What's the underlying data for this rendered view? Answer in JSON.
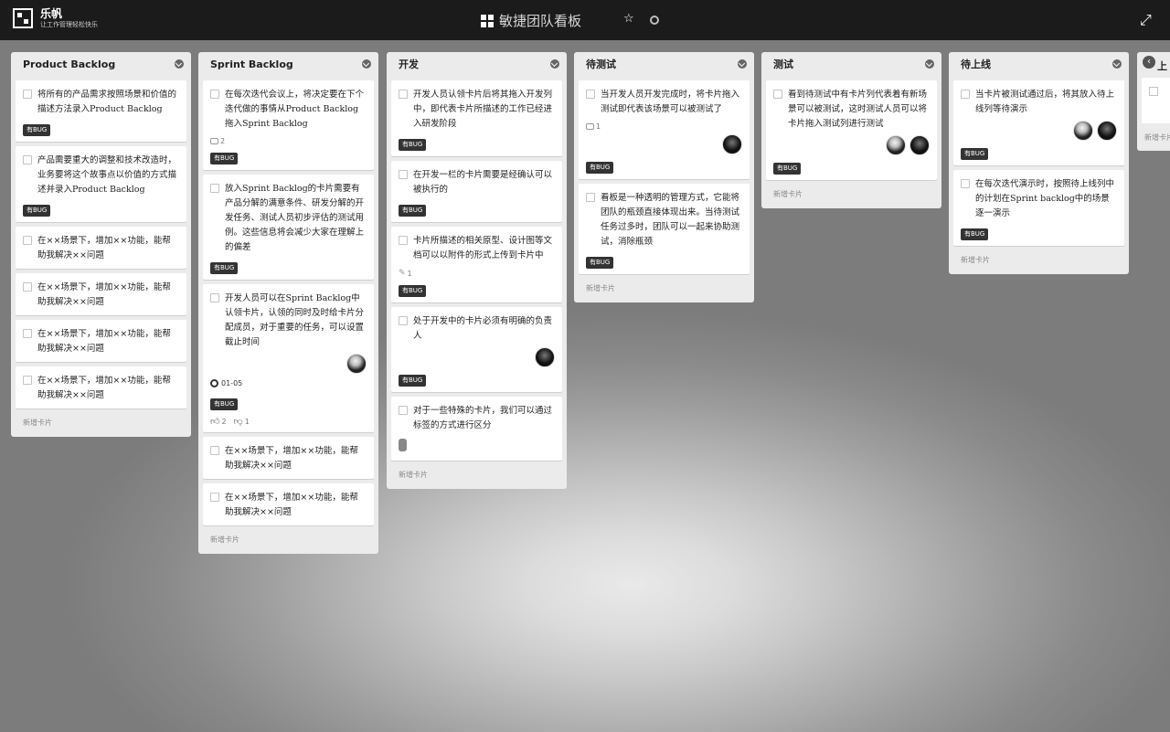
{
  "app": {
    "name": "乐帆",
    "tagline": "让工作管理轻松快乐"
  },
  "board": {
    "title": "敏捷团队看板"
  },
  "add_card_label": "新增卡片",
  "partial_list": {
    "title": "上"
  },
  "lists": [
    {
      "title": "Product Backlog",
      "cards": [
        {
          "text": "将所有的产品需求按照场景和价值的描述方法录入Product Backlog",
          "label": "有BUG"
        },
        {
          "text": "产品需要重大的调整和技术改造时，业务要将这个故事点以价值的方式描述并录入Product Backlog",
          "label": "有BUG"
        },
        {
          "text": "在××场景下，增加××功能，能帮助我解决××问题"
        },
        {
          "text": "在××场景下，增加××功能，能帮助我解决××问题"
        },
        {
          "text": "在××场景下，增加××功能，能帮助我解决××问题"
        },
        {
          "text": "在××场景下，增加××功能，能帮助我解决××问题"
        }
      ]
    },
    {
      "title": "Sprint Backlog",
      "cards": [
        {
          "text": "在每次迭代会议上，将决定要在下个迭代做的事情从Product Backlog拖入Sprint Backlog",
          "comments": "2",
          "label": "有BUG"
        },
        {
          "text": "放入Sprint Backlog的卡片需要有产品分解的满意条件、研发分解的开发任务、测试人员初步评估的测试用例。这些信息将会减少大家在理解上的偏差",
          "label": "有BUG"
        },
        {
          "text": "开发人员可以在Sprint Backlog中认领卡片，认领的同时及时给卡片分配成员，对于重要的任务，可以设置截止时间",
          "avatars": [
            "light"
          ],
          "due": "01-05",
          "label": "有BUG",
          "likes": "2",
          "dislikes": "1"
        },
        {
          "text": "在××场景下，增加××功能，能帮助我解决××问题"
        },
        {
          "text": "在××场景下，增加××功能，能帮助我解决××问题"
        }
      ]
    },
    {
      "title": "开发",
      "cards": [
        {
          "text": "开发人员认领卡片后将其拖入开发列中，即代表卡片所描述的工作已经进入研发阶段",
          "label": "有BUG"
        },
        {
          "text": "在开发一栏的卡片需要是经确认可以被执行的",
          "label": "有BUG"
        },
        {
          "text": "卡片所描述的相关原型、设计图等文档可以以附件的形式上传到卡片中",
          "attachments": "1",
          "label": "有BUG"
        },
        {
          "text": "处于开发中的卡片必须有明确的负责人",
          "avatars": [
            "dark"
          ],
          "label": "有BUG"
        },
        {
          "text": "对于一些特殊的卡片，我们可以通过标签的方式进行区分",
          "pill": true
        }
      ]
    },
    {
      "title": "待测试",
      "cards": [
        {
          "text": "当开发人员开发完成时，将卡片拖入测试即代表该场景可以被测试了",
          "comments": "1",
          "avatars": [
            "dark"
          ],
          "label": "有BUG"
        },
        {
          "text": "看板是一种透明的管理方式，它能将团队的瓶颈直接体现出来。当待测试任务过多时，团队可以一起来协助测试，消除瓶颈",
          "label": "有BUG"
        }
      ]
    },
    {
      "title": "测试",
      "cards": [
        {
          "text": "看到待测试中有卡片列代表着有新场景可以被测试，这时测试人员可以将卡片拖入测试列进行测试",
          "avatars": [
            "light",
            "dark"
          ],
          "label": "有BUG"
        }
      ]
    },
    {
      "title": "待上线",
      "cards": [
        {
          "text": "当卡片被测试通过后，将其放入待上线列等待演示",
          "avatars": [
            "light",
            "dark"
          ],
          "label": "有BUG"
        },
        {
          "text": "在每次迭代演示时，按照待上线列中的计划在Sprint backlog中的场景逐一演示",
          "label": "有BUG"
        }
      ]
    }
  ]
}
